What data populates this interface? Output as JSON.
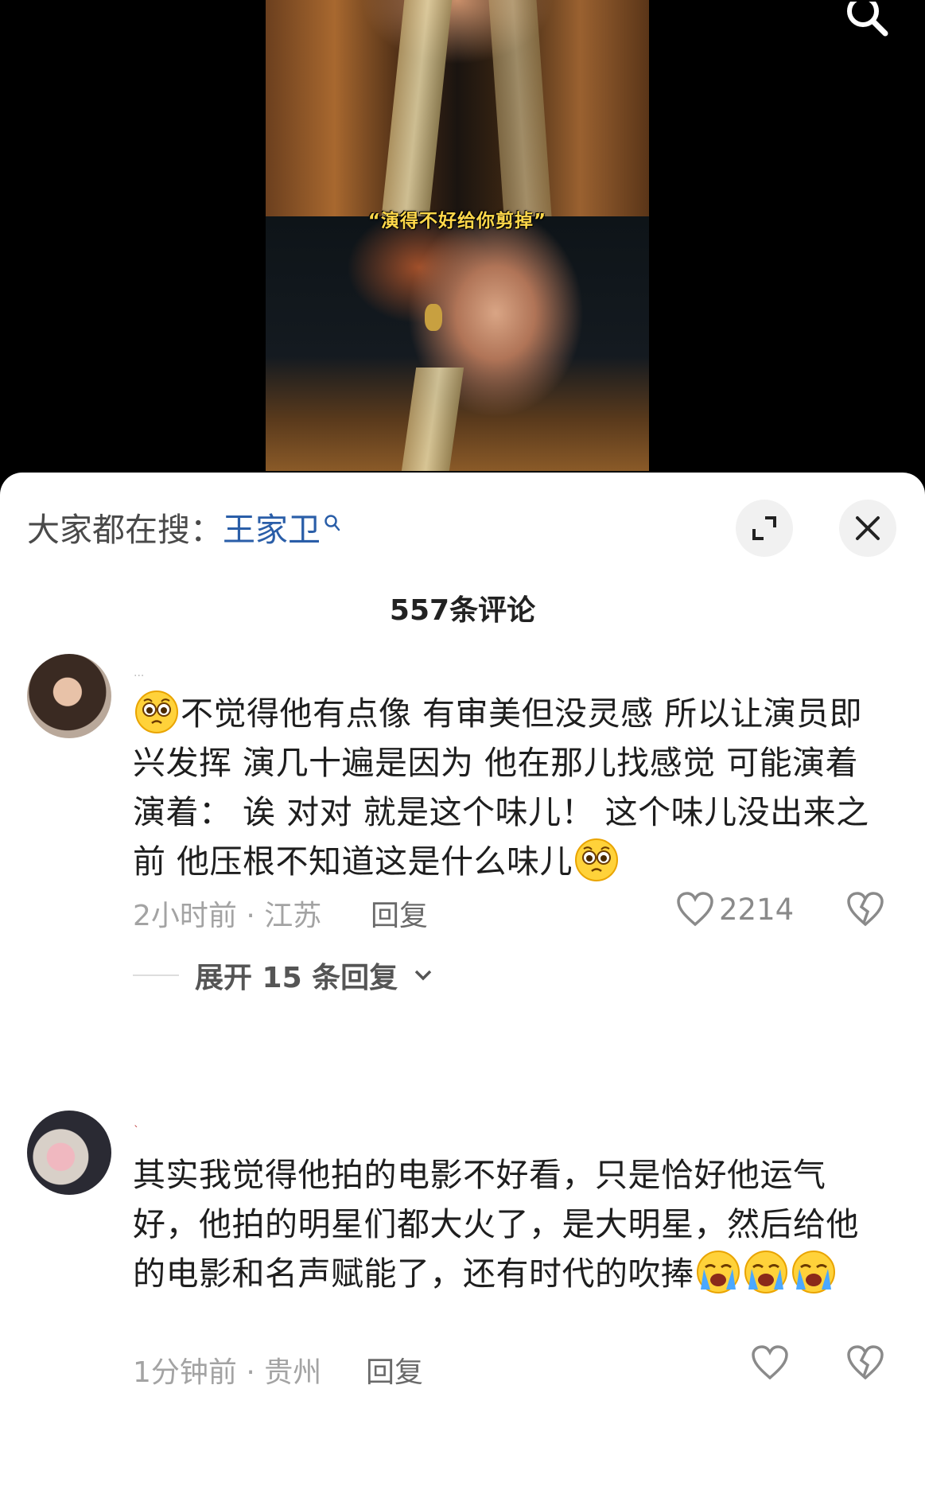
{
  "video": {
    "subtitle": "“演得不好给你剪掉”"
  },
  "panel": {
    "search_prefix": "大家都在搜：",
    "search_keyword": "王家卫",
    "comment_count_title": "557条评论"
  },
  "comments": [
    {
      "username": "...",
      "text_parts": [
        "不觉得他有点像 有审美但没灵感 所以让演员即兴发挥 演几十遍是因为 他在那儿找感觉 可能演着演着： 诶 对对 就是这个味儿！ 这个味儿没出来之前 他压根不知道这是什么味儿"
      ],
      "emoji_lead": "pleading-face",
      "emoji_trail": "pleading-face",
      "time_location": "2小时前 · 江苏",
      "reply_label": "回复",
      "likes": "2214",
      "expand_label": "展开 15 条回复"
    },
    {
      "username": "`",
      "text": "其实我觉得他拍的电影不好看，只是恰好他运气好，他拍的明星们都大火了，是大明星，然后给他的电影和名声赋能了，还有时代的吹捧",
      "emoji_trail": "loudly-crying-face",
      "emoji_count": 3,
      "time_location": "1分钟前 · 贵州",
      "reply_label": "回复"
    }
  ],
  "colors": {
    "keyword": "#2a5ea8",
    "meta": "#a3a3a3",
    "subtitle": "#ffd84a"
  }
}
